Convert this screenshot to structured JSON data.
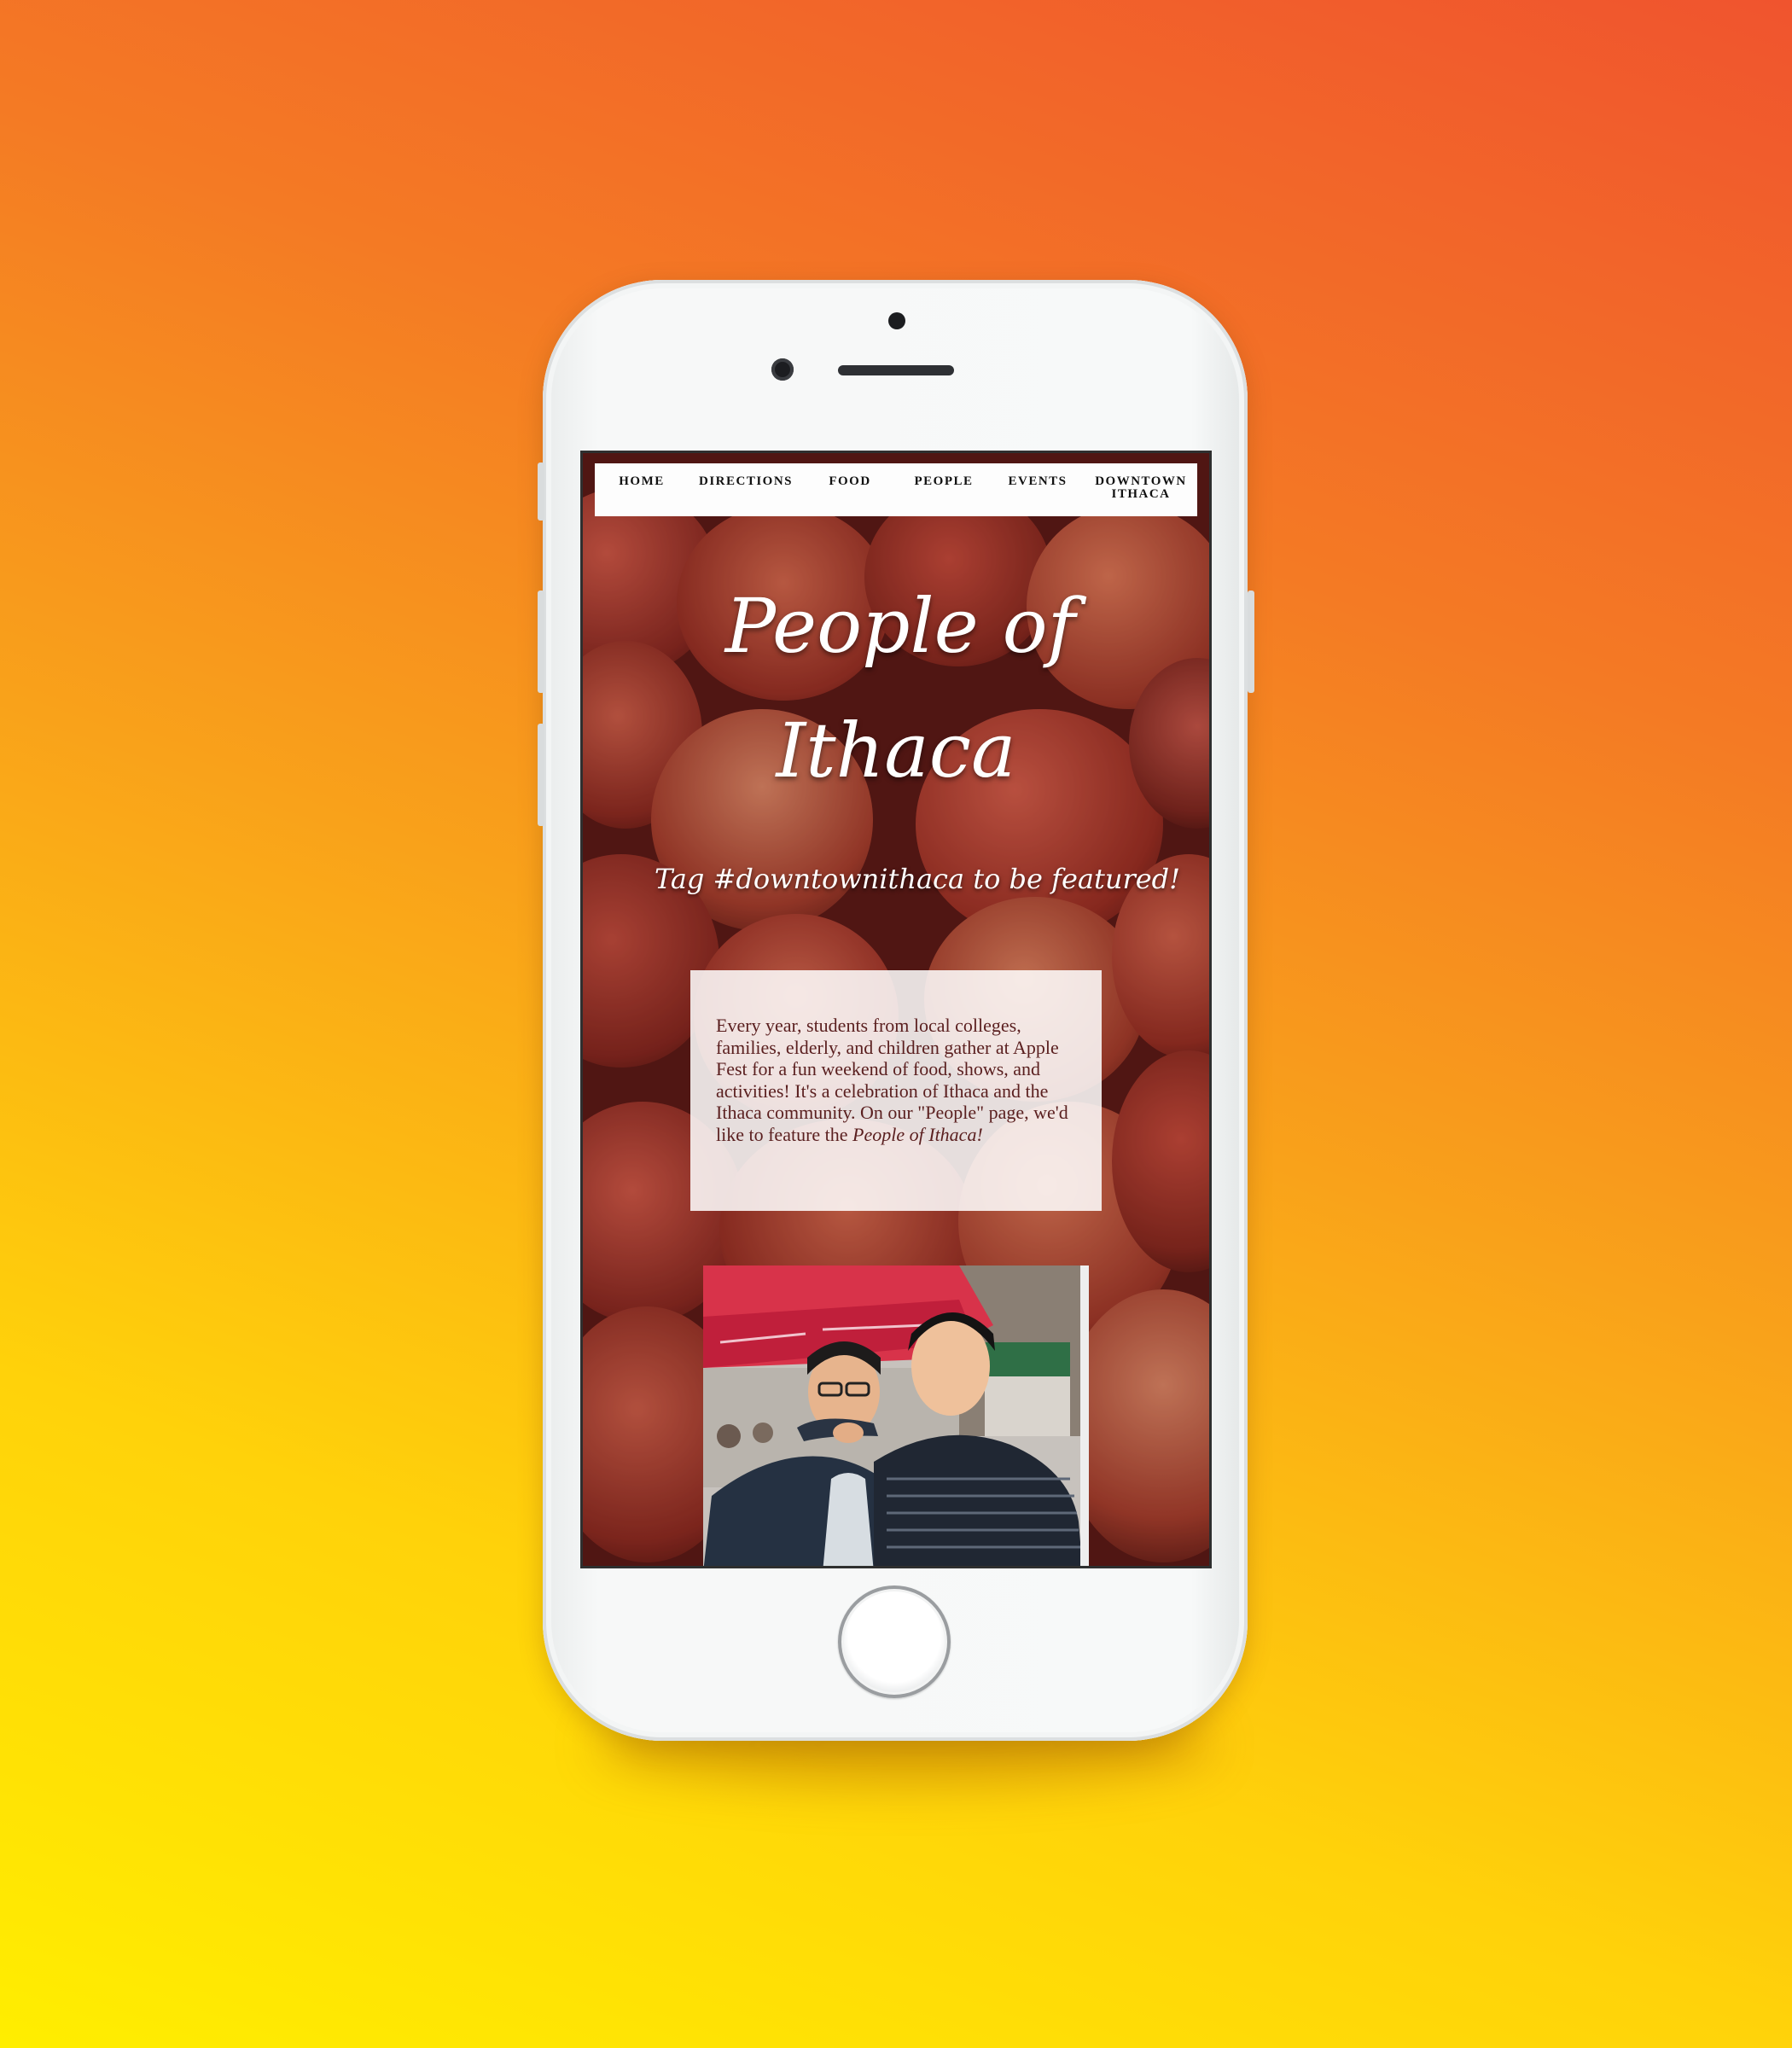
{
  "nav": {
    "items": [
      "HOME",
      "DIRECTIONS",
      "FOOD",
      "PEOPLE",
      "EVENTS"
    ],
    "downtown_line1": "DOWNTOWN",
    "downtown_line2": "ITHACA"
  },
  "hero": {
    "title_line1": "People of",
    "title_line2": "Ithaca",
    "tagline": "Tag #downtownithaca to be featured!"
  },
  "intro": {
    "text": "Every year, students from local colleges, families, elderly, and children gather at Apple Fest for a fun weekend of food, shows, and activities! It's a celebration of Ithaca and the Ithaca community. On our \"People\" page, we'd like to feature the ",
    "emphasis": "People of Ithaca!"
  },
  "colors": {
    "background_top": "#f0542e",
    "background_bottom": "#ffee00",
    "nav_bg": "#fdfdfd",
    "card_text": "#5a1f1f"
  }
}
